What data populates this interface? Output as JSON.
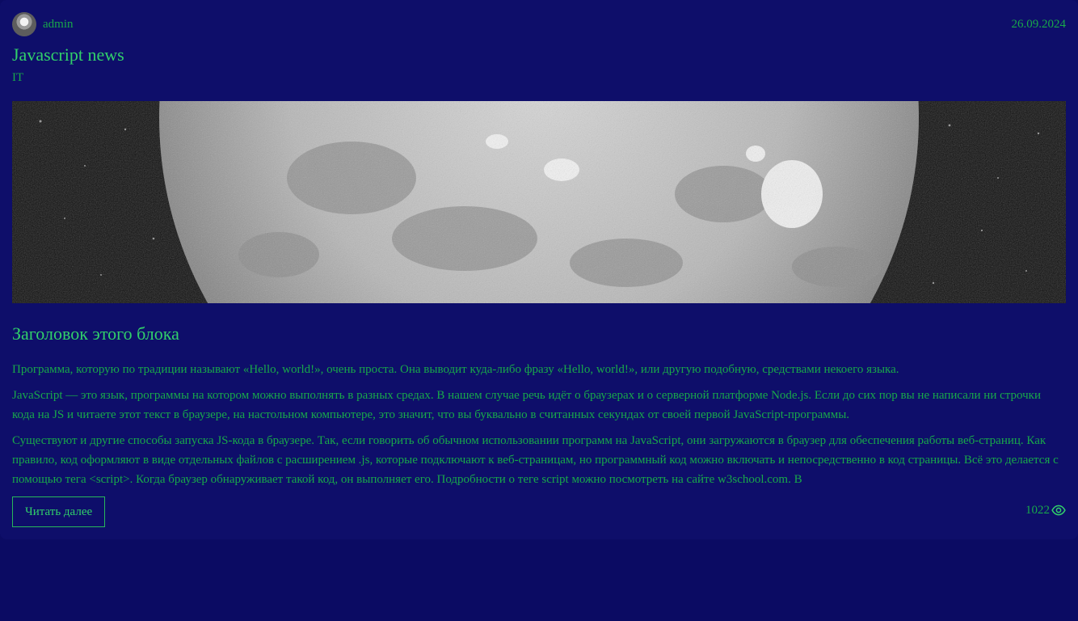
{
  "post": {
    "author": "admin",
    "date": "26.09.2024",
    "title": "Javascript news",
    "category": "IT",
    "image_alt": "moon-illustration",
    "section_heading": "Заголовок этого блока",
    "paragraphs": [
      "Программа, которую по традиции называют «Hello, world!», очень проста. Она выводит куда-либо фразу «Hello, world!», или другую подобную, средствами некоего языка.",
      "JavaScript — это язык, программы на котором можно выполнять в разных средах. В нашем случае речь идёт о браузерах и о серверной платформе Node.js. Если до сих пор вы не написали ни строчки кода на JS и читаете этот текст в браузере, на настольном компьютере, это значит, что вы буквально в считанных секундах от своей первой JavaScript-программы.",
      "Существуют и другие способы запуска JS-кода в браузере. Так, если говорить об обычном использовании программ на JavaScript, они загружаются в браузер для обеспечения работы веб-страниц. Как правило, код оформляют в виде отдельных файлов с расширением .js, которые подключают к веб-страницам, но программный код можно включать и непосредственно в код страницы. Всё это делается с помощью тега <script>. Когда браузер обнаруживает такой код, он выполняет его. Подробности о теге script можно посмотреть на сайте w3school.com. В"
    ],
    "read_more_label": "Читать далее",
    "views": "1022"
  },
  "icons": {
    "avatar": "user-avatar",
    "views": "eye-icon"
  },
  "colors": {
    "background": "#0b0b63",
    "card": "#0e0e6a",
    "accent": "#31d06a",
    "text": "#18a84a"
  }
}
